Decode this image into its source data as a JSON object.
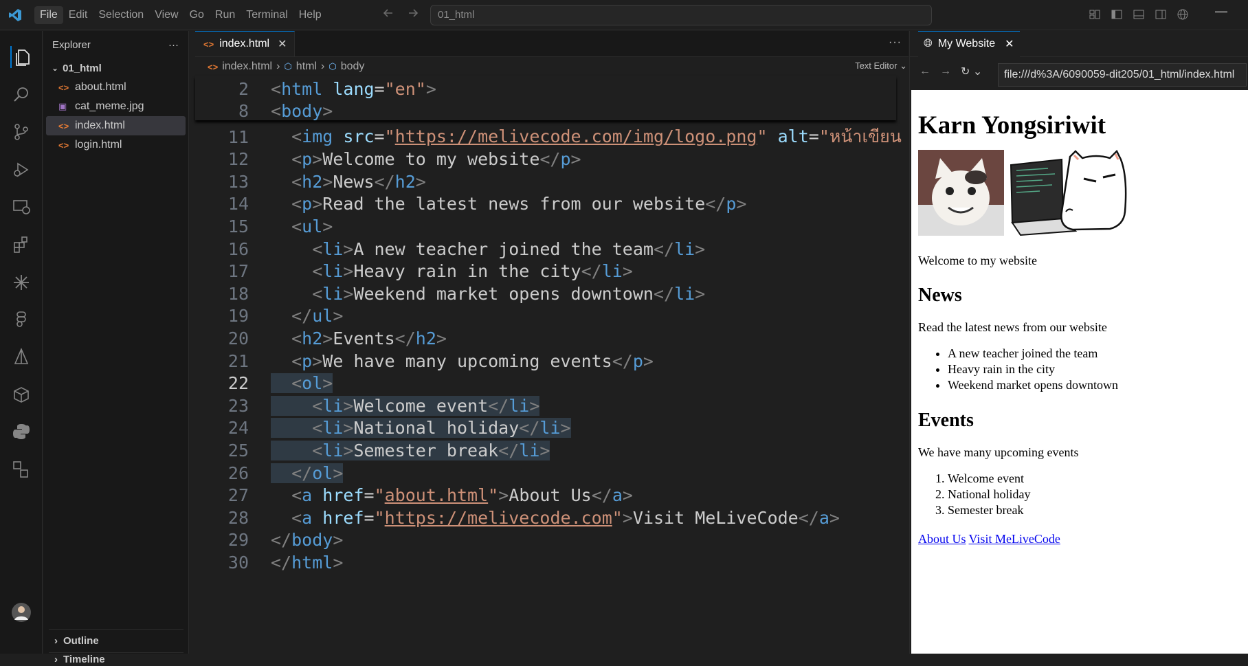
{
  "menubar": {
    "items": [
      "File",
      "Edit",
      "Selection",
      "View",
      "Go",
      "Run",
      "Terminal",
      "Help"
    ],
    "command_center": "01_html"
  },
  "explorer": {
    "title": "Explorer",
    "more": "···",
    "folder": "01_html",
    "files": [
      "about.html",
      "cat_meme.jpg",
      "index.html",
      "login.html"
    ],
    "outline": "Outline",
    "timeline": "Timeline"
  },
  "editor": {
    "tab": "index.html",
    "more": "···",
    "breadcrumbs": [
      "index.html",
      "html",
      "body"
    ],
    "text_editor_label": "Text Editor",
    "sticky": [
      {
        "n": "2",
        "html": "<span class=\"p\">&lt;</span><span class=\"t\">html</span> <span class=\"a\">lang</span>=<span class=\"s\">\"en\"</span><span class=\"p\">&gt;</span>"
      },
      {
        "n": "8",
        "html": "<span class=\"p\">&lt;</span><span class=\"t\">body</span><span class=\"p\">&gt;</span>"
      }
    ],
    "lines": [
      {
        "n": "11",
        "html": "  <span class=\"p\">&lt;</span><span class=\"t\">img</span> <span class=\"a\">src</span>=<span class=\"s\">\"<span class=\"u\">https://melivecode.com/img/logo.png</span>\"</span> <span class=\"a\">alt</span>=<span class=\"s\">\"หน้าเขียน</span>"
      },
      {
        "n": "12",
        "html": "  <span class=\"p\">&lt;</span><span class=\"t\">p</span><span class=\"p\">&gt;</span>Welcome to my website<span class=\"p\">&lt;/</span><span class=\"t\">p</span><span class=\"p\">&gt;</span>"
      },
      {
        "n": "13",
        "html": "  <span class=\"p\">&lt;</span><span class=\"t\">h2</span><span class=\"p\">&gt;</span>News<span class=\"p\">&lt;/</span><span class=\"t\">h2</span><span class=\"p\">&gt;</span>"
      },
      {
        "n": "14",
        "html": "  <span class=\"p\">&lt;</span><span class=\"t\">p</span><span class=\"p\">&gt;</span>Read the latest news from our website<span class=\"p\">&lt;/</span><span class=\"t\">p</span><span class=\"p\">&gt;</span>"
      },
      {
        "n": "15",
        "html": "  <span class=\"p\">&lt;</span><span class=\"t\">ul</span><span class=\"p\">&gt;</span>"
      },
      {
        "n": "16",
        "html": "    <span class=\"p\">&lt;</span><span class=\"t\">li</span><span class=\"p\">&gt;</span>A new teacher joined the team<span class=\"p\">&lt;/</span><span class=\"t\">li</span><span class=\"p\">&gt;</span>"
      },
      {
        "n": "17",
        "html": "    <span class=\"p\">&lt;</span><span class=\"t\">li</span><span class=\"p\">&gt;</span>Heavy rain in the city<span class=\"p\">&lt;/</span><span class=\"t\">li</span><span class=\"p\">&gt;</span>"
      },
      {
        "n": "18",
        "html": "    <span class=\"p\">&lt;</span><span class=\"t\">li</span><span class=\"p\">&gt;</span>Weekend market opens downtown<span class=\"p\">&lt;/</span><span class=\"t\">li</span><span class=\"p\">&gt;</span>"
      },
      {
        "n": "19",
        "html": "  <span class=\"p\">&lt;/</span><span class=\"t\">ul</span><span class=\"p\">&gt;</span>"
      },
      {
        "n": "20",
        "html": "  <span class=\"p\">&lt;</span><span class=\"t\">h2</span><span class=\"p\">&gt;</span>Events<span class=\"p\">&lt;/</span><span class=\"t\">h2</span><span class=\"p\">&gt;</span>"
      },
      {
        "n": "21",
        "html": "  <span class=\"p\">&lt;</span><span class=\"t\">p</span><span class=\"p\">&gt;</span>We have many upcoming events<span class=\"p\">&lt;/</span><span class=\"t\">p</span><span class=\"p\">&gt;</span>"
      },
      {
        "n": "22",
        "html": "<span class=\"hl\">  <span class=\"p\">&lt;</span><span class=\"t\">ol</span><span class=\"p\">&gt;</span></span>",
        "cur": true
      },
      {
        "n": "23",
        "html": "<span class=\"hl\">    <span class=\"p\">&lt;</span><span class=\"t\">li</span><span class=\"p\">&gt;</span>Welcome event<span class=\"p\">&lt;/</span><span class=\"t\">li</span><span class=\"p\">&gt;</span></span>"
      },
      {
        "n": "24",
        "html": "<span class=\"hl\">    <span class=\"p\">&lt;</span><span class=\"t\">li</span><span class=\"p\">&gt;</span>National holiday<span class=\"p\">&lt;/</span><span class=\"t\">li</span><span class=\"p\">&gt;</span></span>"
      },
      {
        "n": "25",
        "html": "<span class=\"hl\">    <span class=\"p\">&lt;</span><span class=\"t\">li</span><span class=\"p\">&gt;</span>Semester break<span class=\"p\">&lt;/</span><span class=\"t\">li</span><span class=\"p\">&gt;</span></span>"
      },
      {
        "n": "26",
        "html": "<span class=\"hl\">  <span class=\"p\">&lt;/</span><span class=\"t\">ol</span><span class=\"p\">&gt;</span></span>"
      },
      {
        "n": "27",
        "html": "  <span class=\"p\">&lt;</span><span class=\"t\">a</span> <span class=\"a\">href</span>=<span class=\"s\">\"<span class=\"u\">about.html</span>\"</span><span class=\"p\">&gt;</span>About Us<span class=\"p\">&lt;/</span><span class=\"t\">a</span><span class=\"p\">&gt;</span>"
      },
      {
        "n": "28",
        "html": "  <span class=\"p\">&lt;</span><span class=\"t\">a</span> <span class=\"a\">href</span>=<span class=\"s\">\"<span class=\"u\">https://melivecode.com</span>\"</span><span class=\"p\">&gt;</span>Visit MeLiveCode<span class=\"p\">&lt;/</span><span class=\"t\">a</span><span class=\"p\">&gt;</span>"
      },
      {
        "n": "29",
        "html": "<span class=\"p\">&lt;/</span><span class=\"t\">body</span><span class=\"p\">&gt;</span>"
      },
      {
        "n": "30",
        "html": "<span class=\"p\">&lt;/</span><span class=\"t\">html</span><span class=\"p\">&gt;</span>"
      }
    ]
  },
  "preview": {
    "tab": "My Website",
    "url": "file:///d%3A/6090059-dit205/01_html/index.html",
    "h1": "Karn Yongsiriwit",
    "welcome": "Welcome to my website",
    "news_heading": "News",
    "news_text": "Read the latest news from our website",
    "news_items": [
      "A new teacher joined the team",
      "Heavy rain in the city",
      "Weekend market opens downtown"
    ],
    "events_heading": "Events",
    "events_text": "We have many upcoming events",
    "events_items": [
      "Welcome event",
      "National holiday",
      "Semester break"
    ],
    "links": [
      "About Us",
      "Visit MeLiveCode"
    ]
  },
  "colors": {
    "accent": "#0078d4",
    "tag": "#569cd6",
    "attr": "#9cdcfe",
    "string": "#ce9178",
    "html_icon": "#e37933",
    "image_icon": "#a074c4"
  }
}
